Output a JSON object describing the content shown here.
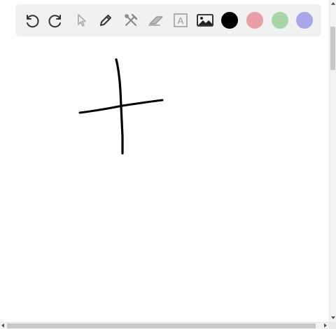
{
  "toolbar": {
    "tools": [
      {
        "name": "undo-icon",
        "enabled": true
      },
      {
        "name": "redo-icon",
        "enabled": true
      },
      {
        "name": "select-pointer-icon",
        "enabled": false
      },
      {
        "name": "pencil-icon",
        "enabled": true,
        "selected": true
      },
      {
        "name": "tools-crossed-icon",
        "enabled": true
      },
      {
        "name": "eraser-icon",
        "enabled": true
      },
      {
        "name": "text-box-icon",
        "enabled": true
      },
      {
        "name": "image-icon",
        "enabled": true
      }
    ],
    "text_tool_label": "A",
    "colors": [
      {
        "name": "black",
        "hex": "#000000",
        "selected": true
      },
      {
        "name": "pink",
        "hex": "#e8a0a8"
      },
      {
        "name": "green",
        "hex": "#a8d4a8"
      },
      {
        "name": "lavender",
        "hex": "#a8a8e8"
      }
    ]
  },
  "drawing": {
    "stroke_color": "#000000",
    "strokes": 2
  }
}
